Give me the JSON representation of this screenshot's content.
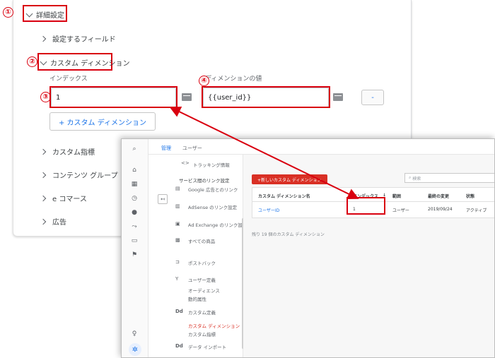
{
  "annotations": {
    "n1": "①",
    "n2": "②",
    "n3": "③",
    "n4": "④"
  },
  "settings": {
    "advanced": "詳細設定",
    "fields_to_set": "設定するフィールド",
    "custom_dimensions": "カスタム ディメンション",
    "index_label": "インデックス",
    "dimension_value_label": "ディメンションの値",
    "index_value": "1",
    "dimension_value": "{{user_id}}",
    "remove_button": "-",
    "add_custom_dimension": "+ カスタム ディメンション",
    "custom_metrics": "カスタム指標",
    "content_group": "コンテンツ グループ",
    "ecommerce": "e コマース",
    "ads": "広告"
  },
  "ga_window": {
    "tabs": [
      "管理",
      "ユーザー"
    ],
    "tracking_info": "トラッキング情報",
    "service_links_header": "サービス間のリンク設定",
    "nav": {
      "google_ads": "Google 広告とのリンク",
      "adsense": "AdSense のリンク設定",
      "ad_exchange": "Ad Exchange のリンク設定",
      "all_products": "すべての商品",
      "postback": "ポストバック",
      "user_definitions": "ユーザー定義",
      "audiences": "オーディエンス",
      "dynamic_attributes": "動的属性",
      "custom_definitions": "カスタム定義",
      "custom_dimensions": "カスタム ディメンション",
      "custom_metrics": "カスタム指標",
      "data_import": "データ インポート",
      "dd_label": "Dd"
    },
    "new_custom_dimension_button": "+新しいカスタム ディメンション",
    "search_placeholder": "検索",
    "table": {
      "headers": [
        "カスタム ディメンション名",
        "インデックス",
        "範囲",
        "最終の変更",
        "状態"
      ],
      "sort_glyph": "↓",
      "row": [
        "ユーザーID",
        "1",
        "ユーザー",
        "2019/09/24",
        "アクティブ"
      ]
    },
    "remaining_text": "残り 19 個のカスタム ディメンション"
  }
}
